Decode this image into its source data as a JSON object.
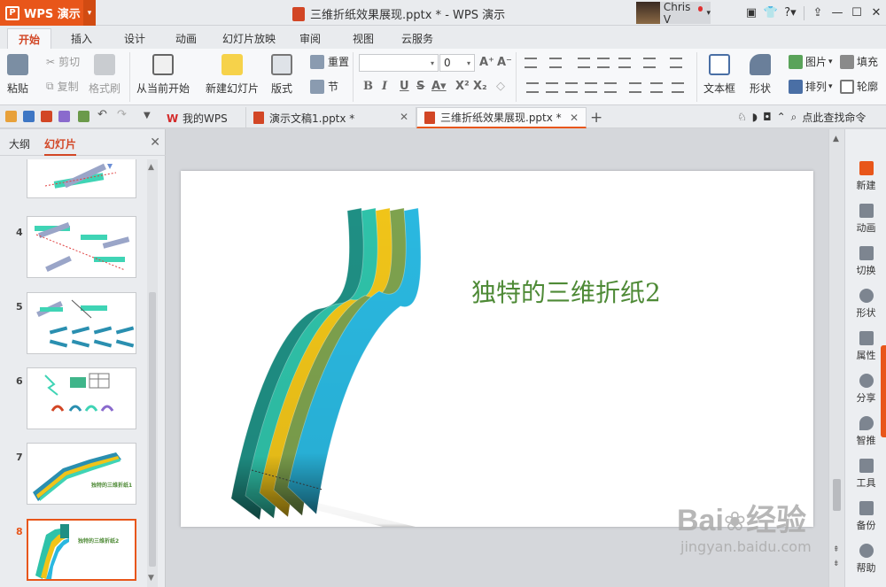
{
  "app": {
    "name": "WPS 演示",
    "doc_title": "三维折纸效果展现.pptx * - WPS 演示",
    "user": "Chris V"
  },
  "menu_tabs": [
    "开始",
    "插入",
    "设计",
    "动画",
    "幻灯片放映",
    "审阅",
    "视图",
    "云服务"
  ],
  "ribbon": {
    "paste": "粘贴",
    "cut": "剪切",
    "copy": "复制",
    "format_painter": "格式刷",
    "from_current": "从当前开始",
    "new_slide": "新建幻灯片",
    "layout": "版式",
    "reset": "重置",
    "section": "节",
    "font_size": "0",
    "textbox": "文本框",
    "shape": "形状",
    "picture": "图片",
    "fill": "填充",
    "arrange": "排列",
    "outline": "轮廓"
  },
  "doc_tabs": {
    "my_wps": "我的WPS",
    "tab1": "演示文稿1.pptx *",
    "tab2": "三维折纸效果展现.pptx *",
    "search": "点此查找命令"
  },
  "left_panel": {
    "outline_tab": "大纲",
    "slides_tab": "幻灯片",
    "slide_numbers": [
      "4",
      "5",
      "6",
      "7",
      "8"
    ],
    "thumb7_text": "独特的三维折纸1",
    "thumb8_text": "独特的三维折纸2"
  },
  "slide": {
    "title": "独特的三维折纸2",
    "title_color": "#4e8a36",
    "stripe_colors": [
      "#1f8f84",
      "#2fc2a9",
      "#f0c419",
      "#7ea24e",
      "#2ab8e0"
    ]
  },
  "right_bar": [
    "新建",
    "动画",
    "切换",
    "形状",
    "属性",
    "分享",
    "智推",
    "工具",
    "备份",
    "帮助"
  ],
  "watermark": {
    "brand": "Bai",
    "brand2": "经验",
    "url": "jingyan.baidu.com"
  },
  "colors": {
    "accent": "#e8561a"
  }
}
